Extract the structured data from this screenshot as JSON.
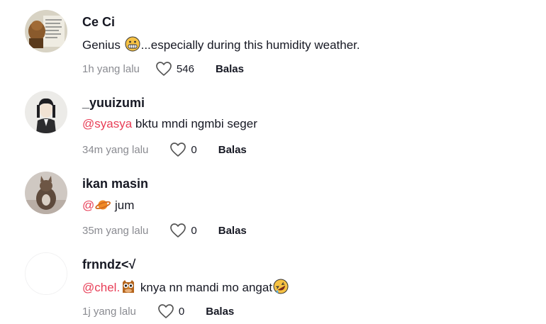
{
  "comments": [
    {
      "username": "Ce Ci",
      "text_before": "Genius",
      "mention": "",
      "emoji_1": "grinning-face-emoji",
      "text_after": "...especially during this humidity weather.",
      "time": "1h yang lalu",
      "likes": "546",
      "reply_label": "Balas"
    },
    {
      "username": "_yuuizumi",
      "mention": "@syasya",
      "text_after": " bktu mndi ngmbi seger",
      "time": "34m yang lalu",
      "likes": "0",
      "reply_label": "Balas"
    },
    {
      "username": "ikan masin",
      "mention": "@",
      "emoji_1": "ringed-planet-emoji",
      "text_after": " jum",
      "time": "35m yang lalu",
      "likes": "0",
      "reply_label": "Balas"
    },
    {
      "username": "frnndz<√",
      "mention": "@chel.",
      "emoji_1": "owl-emoji",
      "text_after": " knya nn mandi mo angat",
      "emoji_2": "rolling-laughing-emoji",
      "time": "1j yang lalu",
      "likes": "0",
      "reply_label": "Balas"
    }
  ],
  "colors": {
    "mention": "#e83e57",
    "secondary_text": "#8a8b91",
    "primary_text": "#161823"
  }
}
